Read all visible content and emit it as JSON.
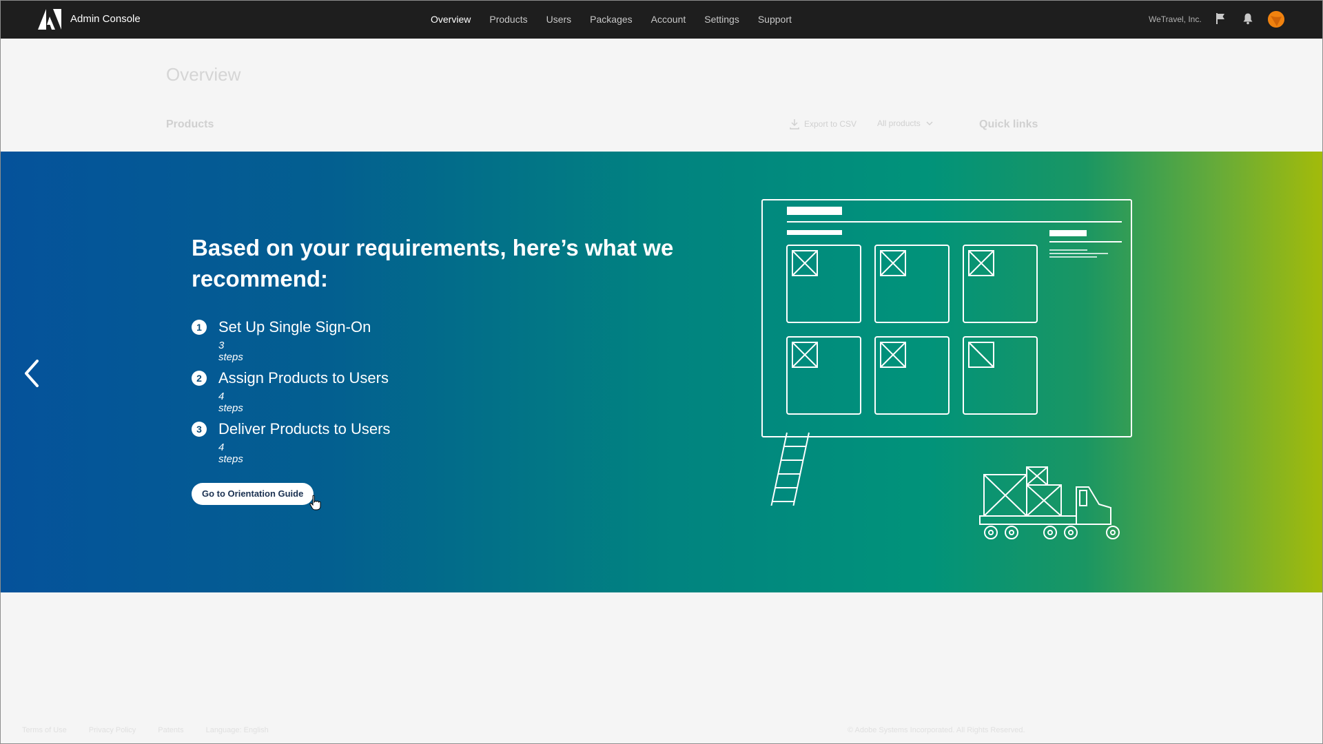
{
  "app": {
    "title": "Admin Console",
    "org_name": "WeTravel, Inc.",
    "brand_color": "#f0820f"
  },
  "nav": {
    "items": [
      {
        "label": "Overview",
        "active": true
      },
      {
        "label": "Products",
        "active": false
      },
      {
        "label": "Users",
        "active": false
      },
      {
        "label": "Packages",
        "active": false
      },
      {
        "label": "Account",
        "active": false
      },
      {
        "label": "Settings",
        "active": false
      },
      {
        "label": "Support",
        "active": false
      }
    ]
  },
  "page": {
    "title": "Overview",
    "products_label": "Products",
    "export_label": "Export to CSV",
    "filter_label": "All products",
    "quick_links_label": "Quick links"
  },
  "banner": {
    "headline": "Based on your requirements, here’s what we recommend:",
    "steps": [
      {
        "number": "1",
        "title": "Set Up Single Sign-On",
        "subtitle": "3 steps"
      },
      {
        "number": "2",
        "title": "Assign Products to Users",
        "subtitle": "4 steps"
      },
      {
        "number": "3",
        "title": "Deliver Products to Users",
        "subtitle": "4 steps"
      }
    ],
    "cta_label": "Go to Orientation Guide",
    "gradient_start": "#05529b",
    "gradient_end": "#a3bb0a"
  },
  "footer": {
    "links": [
      "Terms of Use",
      "Privacy Policy",
      "Patents",
      "Language: English"
    ],
    "copyright": "© Adobe Systems Incorporated. All Rights Reserved."
  },
  "icons": [
    "adobe-logo-icon",
    "flag-icon",
    "bell-icon",
    "download-icon",
    "chevron-down-icon",
    "chevron-left-icon",
    "hand-cursor-icon"
  ]
}
